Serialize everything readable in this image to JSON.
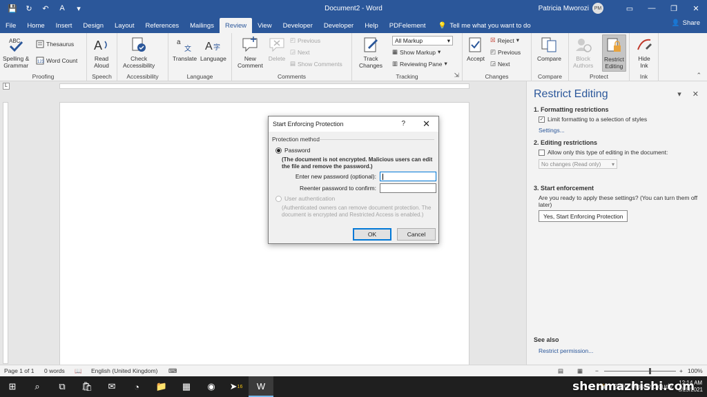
{
  "titlebar": {
    "doc_title": "Document2 - Word",
    "user_name": "Patricia Mworozi",
    "user_initials": "PM"
  },
  "tabs": [
    "File",
    "Home",
    "Insert",
    "Design",
    "Layout",
    "References",
    "Mailings",
    "Review",
    "View",
    "Developer",
    "Developer",
    "Help",
    "PDFelement"
  ],
  "active_tab": "Review",
  "tell_me": "Tell me what you want to do",
  "share": "Share",
  "ribbon": {
    "proofing": {
      "label": "Proofing",
      "spelling": "Spelling &",
      "spelling2": "Grammar",
      "thesaurus": "Thesaurus",
      "word_count": "Word Count"
    },
    "speech": {
      "label": "Speech",
      "read": "Read",
      "read2": "Aloud"
    },
    "accessibility": {
      "label": "Accessibility",
      "check": "Check",
      "check2": "Accessibility"
    },
    "language": {
      "label": "Language",
      "translate": "Translate",
      "language": "Language"
    },
    "comments": {
      "label": "Comments",
      "new": "New",
      "new2": "Comment",
      "delete": "Delete",
      "previous": "Previous",
      "next": "Next",
      "show": "Show Comments"
    },
    "tracking": {
      "label": "Tracking",
      "track": "Track",
      "track2": "Changes",
      "markup": "All Markup",
      "show_markup": "Show Markup",
      "reviewing_pane": "Reviewing Pane"
    },
    "changes": {
      "label": "Changes",
      "accept": "Accept",
      "reject": "Reject",
      "previous": "Previous",
      "next": "Next"
    },
    "compare": {
      "label": "Compare",
      "compare": "Compare"
    },
    "protect": {
      "label": "Protect",
      "block": "Block",
      "block2": "Authors",
      "restrict": "Restrict",
      "restrict2": "Editing"
    },
    "ink": {
      "label": "Ink",
      "hide": "Hide",
      "hide2": "Ink"
    }
  },
  "pane": {
    "title": "Restrict Editing",
    "s1_heading": "1. Formatting restrictions",
    "s1_checkbox": "Limit formatting to a selection of styles",
    "s1_checked": true,
    "s1_link": "Settings...",
    "s2_heading": "2. Editing restrictions",
    "s2_checkbox": "Allow only this type of editing in the document:",
    "s2_checked": false,
    "s2_combo": "No changes (Read only)",
    "s3_heading": "3. Start enforcement",
    "s3_text": "Are you ready to apply these settings? (You can turn them off later)",
    "s3_button": "Yes, Start Enforcing Protection",
    "see_also": "See also",
    "see_also_link": "Restrict permission..."
  },
  "dialog": {
    "title": "Start Enforcing Protection",
    "help": "?",
    "section": "Protection method",
    "opt_password": "Password",
    "password_note": "(The document is not encrypted. Malicious users can edit the file and remove the password.)",
    "new_pw_label": "Enter new password (optional):",
    "reenter_label": "Reenter password to confirm:",
    "opt_user_auth": "User authentication",
    "user_auth_note": "(Authenticated owners can remove document protection. The document is encrypted and Restricted Access is enabled.)",
    "ok": "OK",
    "cancel": "Cancel"
  },
  "status": {
    "page": "Page 1 of 1",
    "words": "0 words",
    "language": "English (United Kingdom)",
    "zoom": "100%"
  },
  "taskbar": {
    "weather": "20°C  Mostly cloudy",
    "time": "12:14 AM",
    "date": "6/25/2021",
    "watermark": "shenmazhishi.com",
    "badge": "16"
  }
}
